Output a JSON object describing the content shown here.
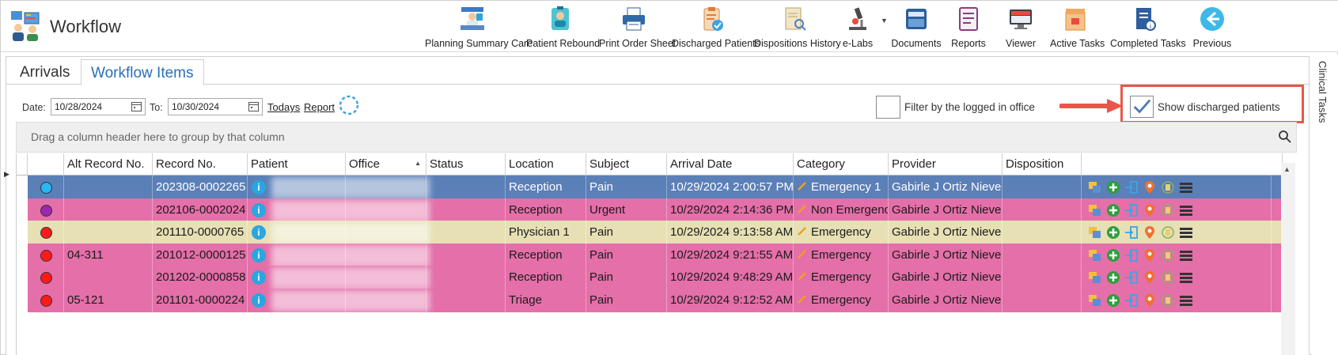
{
  "app": {
    "title": "Workflow"
  },
  "toolbar": [
    {
      "label": "Planning Summary Care",
      "icon": "doctor-desk-icon"
    },
    {
      "label": "Patient Rebound",
      "icon": "patient-badge-icon"
    },
    {
      "label": "Print Order Sheet",
      "icon": "printer-icon"
    },
    {
      "label": "Discharged Patients",
      "icon": "clipboard-check-icon"
    },
    {
      "label": "Dispositions History",
      "icon": "document-search-icon"
    },
    {
      "label": "e-Labs",
      "icon": "microscope-icon"
    },
    {
      "label": "Documents",
      "icon": "inbox-tray-icon"
    },
    {
      "label": "Reports",
      "icon": "report-icon"
    },
    {
      "label": "Viewer",
      "icon": "monitor-icon"
    },
    {
      "label": "Active Tasks",
      "icon": "task-box-icon"
    },
    {
      "label": "Completed Tasks",
      "icon": "task-done-icon"
    },
    {
      "label": "Previous",
      "icon": "back-arrow-icon"
    }
  ],
  "tabs": [
    {
      "label": "Arrivals"
    },
    {
      "label": "Workflow Items"
    }
  ],
  "side_panel": {
    "label": "Clinical Tasks"
  },
  "filters": {
    "date_label": "Date:",
    "date_from": "10/28/2024",
    "to_label": "To:",
    "date_to": "10/30/2024",
    "todays_label": "Todays",
    "report_label": "Report",
    "office_filter_label": "Filter by the logged in office",
    "office_filter_checked": false,
    "show_discharged_label": "Show discharged patients",
    "show_discharged_checked": true
  },
  "grid": {
    "group_prompt": "Drag a column header here to group by that column",
    "columns": [
      "Alt Record No.",
      "Record No.",
      "Patient",
      "Office",
      "Status",
      "Location",
      "Subject",
      "Arrival Date",
      "Category",
      "Provider",
      "Disposition"
    ],
    "rows": [
      {
        "dot": "#29b6f6",
        "bg": "#5b7fb7",
        "fg": "#ffffff",
        "alt": "",
        "rec": "202308-0002265",
        "status": "",
        "loc": "Reception",
        "subj": "Pain",
        "arrival": "10/29/2024 2:00:57 PM",
        "cat": "Emergency 1",
        "prov": "Gabirle J Ortiz Nieves",
        "disp": ""
      },
      {
        "dot": "#9c27b0",
        "bg": "#e46fa9",
        "fg": "#1b1b1b",
        "alt": "",
        "rec": "202106-0002024",
        "status": "",
        "loc": "Reception",
        "subj": "Urgent",
        "arrival": "10/29/2024 2:14:36 PM",
        "cat": "Non Emergency",
        "prov": "Gabirle J Ortiz Nieves",
        "disp": ""
      },
      {
        "dot": "#ff1a1a",
        "bg": "#e6e0b4",
        "fg": "#1b1b1b",
        "alt": "",
        "rec": "201110-0000765",
        "status": "",
        "loc": "Physician 1",
        "subj": "Pain",
        "arrival": "10/29/2024 9:13:58 AM",
        "cat": "Emergency",
        "prov": "Gabirle J Ortiz Nieves",
        "disp": ""
      },
      {
        "dot": "#ff1a1a",
        "bg": "#e46fa9",
        "fg": "#1b1b1b",
        "alt": "04-311",
        "rec": "201012-0000125",
        "status": "",
        "loc": "Reception",
        "subj": "Pain",
        "arrival": "10/29/2024 9:21:55 AM",
        "cat": "Emergency",
        "prov": "Gabirle J Ortiz Nieves",
        "disp": ""
      },
      {
        "dot": "#ff1a1a",
        "bg": "#e46fa9",
        "fg": "#1b1b1b",
        "alt": "",
        "rec": "201202-0000858",
        "status": "",
        "loc": "Reception",
        "subj": "Pain",
        "arrival": "10/29/2024 9:48:29 AM",
        "cat": "Emergency",
        "prov": "Gabirle J Ortiz Nieves",
        "disp": ""
      },
      {
        "dot": "#ff1a1a",
        "bg": "#e46fa9",
        "fg": "#1b1b1b",
        "alt": "05-121",
        "rec": "201101-0000224",
        "status": "",
        "loc": "Triage",
        "subj": "Pain",
        "arrival": "10/29/2024 9:12:52 AM",
        "cat": "Emergency",
        "prov": "Gabirle J Ortiz Nieves",
        "disp": ""
      }
    ]
  },
  "colors": {
    "accent": "#2a6fb8",
    "highlight": "#e8574a",
    "selected_row": "#5b7fb7"
  }
}
